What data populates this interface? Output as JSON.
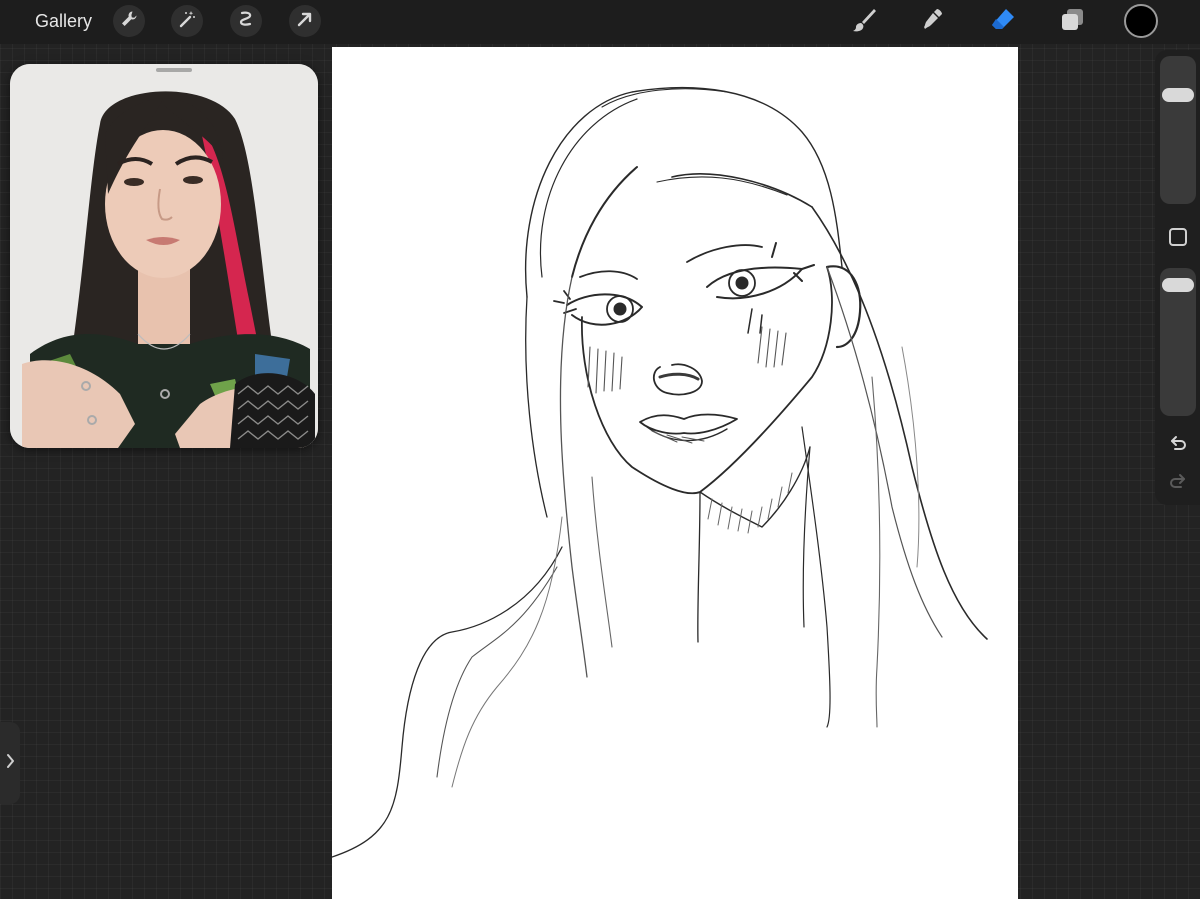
{
  "toolbar": {
    "gallery_label": "Gallery",
    "left_tools": [
      "wrench-icon",
      "magic-wand-icon",
      "selection-icon",
      "transform-arrow-icon"
    ],
    "right_tools": [
      "brush-icon",
      "smudge-icon",
      "eraser-icon",
      "layers-icon"
    ],
    "active_tool": "eraser",
    "active_color": "#000000",
    "accent": "#2f8af5"
  },
  "reference": {
    "content": "reference-photo"
  },
  "sidebar": {
    "brush_size_level": 0.78,
    "opacity_level": 0.95
  },
  "colors": {
    "background": "#232323",
    "toolbar": "#1d1d1d",
    "canvas": "#ffffff"
  }
}
